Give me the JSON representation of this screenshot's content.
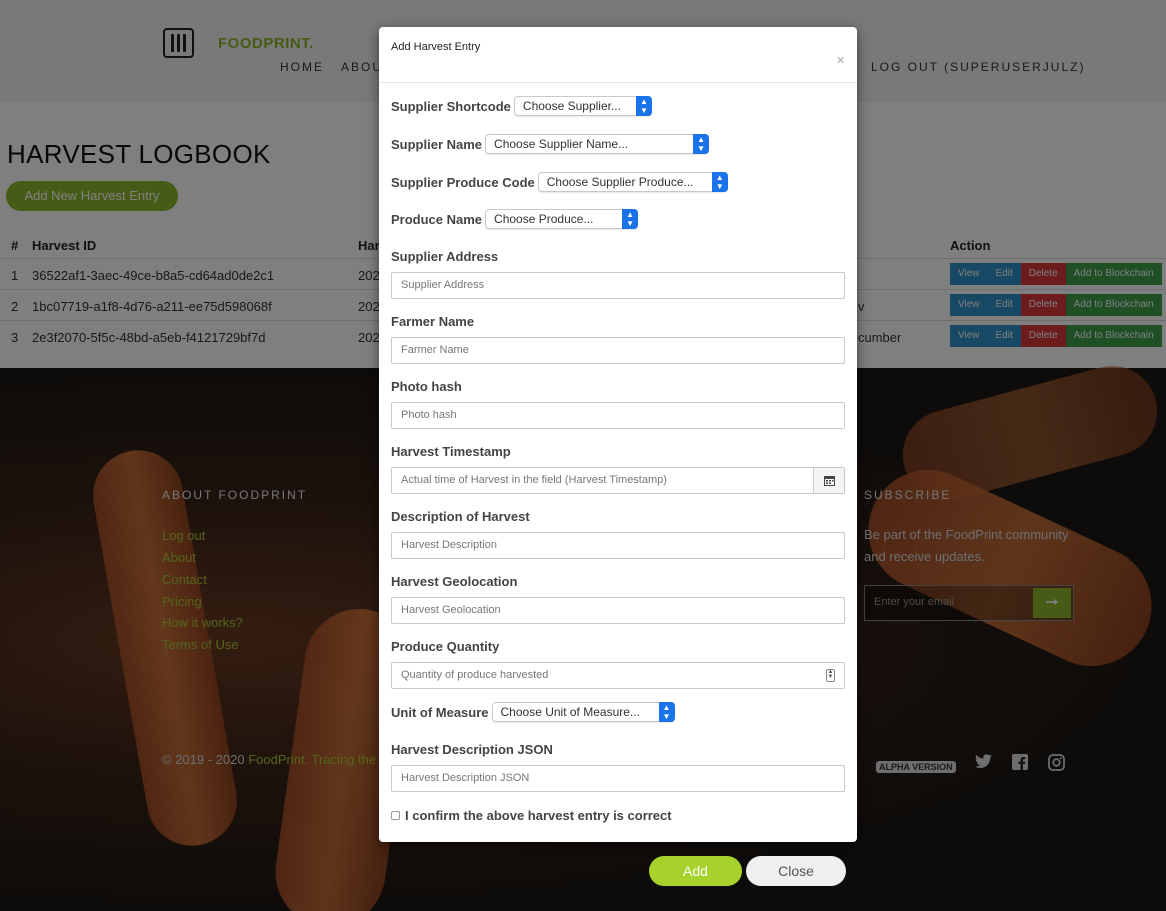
{
  "header": {
    "logo_text": "FOODPRINT.",
    "nav": {
      "home": "HOME",
      "about": "ABOU",
      "logout": "LOG OUT (SUPERUSERJULZ)"
    }
  },
  "page": {
    "title": "HARVEST LOGBOOK",
    "add_new_label": "Add New Harvest Entry",
    "table": {
      "headers": {
        "num": "#",
        "harvest_id": "Harvest ID",
        "col3": "Har",
        "action": "Action"
      },
      "rows": [
        {
          "num": "1",
          "id": "36522af1-3aec-49ce-b8a5-cd64ad0de2c1",
          "col3": "202",
          "col4": ""
        },
        {
          "num": "2",
          "id": "1bc07719-a1f8-4d76-a211-ee75d598068f",
          "col3": "202",
          "col4": "v"
        },
        {
          "num": "3",
          "id": "2e3f2070-5f5c-48bd-a5eb-f4121729bf7d",
          "col3": "202",
          "col4": "cumber"
        }
      ],
      "actions": {
        "view": "View",
        "edit": "Edit",
        "delete": "Delete",
        "blockchain": "Add to Blockchain"
      }
    }
  },
  "footer": {
    "about_heading": "ABOUT FOODPRINT",
    "links": [
      "Log out",
      "About",
      "Contact",
      "Pricing",
      "How it works?",
      "Terms of Use"
    ],
    "subscribe_heading": "SUBSCRIBE",
    "subscribe_text_1": "Be part of the FoodPrint community",
    "subscribe_text_2": "and receive updates.",
    "email_placeholder": "Enter your email",
    "copyright_prefix": "© 2019 - 2020 ",
    "copyright_brand": "FoodPrint. Tracing the wo",
    "alpha_badge": "ALPHA VERSION"
  },
  "modal": {
    "title": "Add Harvest Entry",
    "close_x": "×",
    "supplier_shortcode": {
      "label": "Supplier Shortcode",
      "value": "Choose Supplier..."
    },
    "supplier_name": {
      "label": "Supplier Name",
      "value": "Choose Supplier Name..."
    },
    "supplier_produce_code": {
      "label": "Supplier Produce Code",
      "value": "Choose Supplier Produce..."
    },
    "produce_name": {
      "label": "Produce Name",
      "value": "Choose Produce..."
    },
    "supplier_address": {
      "label": "Supplier Address",
      "placeholder": "Supplier Address"
    },
    "farmer_name": {
      "label": "Farmer Name",
      "placeholder": "Farmer Name"
    },
    "photo_hash": {
      "label": "Photo hash",
      "placeholder": "Photo hash"
    },
    "harvest_timestamp": {
      "label": "Harvest Timestamp",
      "placeholder": "Actual time of Harvest in the field (Harvest Timestamp)"
    },
    "description": {
      "label": "Description of Harvest",
      "placeholder": "Harvest Description"
    },
    "geolocation": {
      "label": "Harvest Geolocation",
      "placeholder": "Harvest Geolocation"
    },
    "quantity": {
      "label": "Produce Quantity",
      "placeholder": "Quantity of produce harvested"
    },
    "unit": {
      "label": "Unit of Measure",
      "value": "Choose Unit of Measure..."
    },
    "json": {
      "label": "Harvest Description JSON",
      "placeholder": "Harvest Description JSON"
    },
    "confirm_label": "I confirm the above harvest entry is correct",
    "add_label": "Add",
    "close_label": "Close"
  },
  "icons": {
    "logo": "fork-carrot-icon",
    "calendar": "calendar-icon",
    "spinner": "number-spinner-icon",
    "chevron": "select-chevron-icon",
    "twitter": "twitter-icon",
    "facebook": "facebook-icon",
    "instagram": "instagram-icon",
    "arrow": "arrow-right-icon"
  },
  "colors": {
    "brand_green": "#8cb92d",
    "add_button": "#a7d22b",
    "view_edit": "#2f93c9",
    "delete": "#d9383a",
    "blockchain": "#3ea14a",
    "select_accent": "#1a73e8"
  }
}
